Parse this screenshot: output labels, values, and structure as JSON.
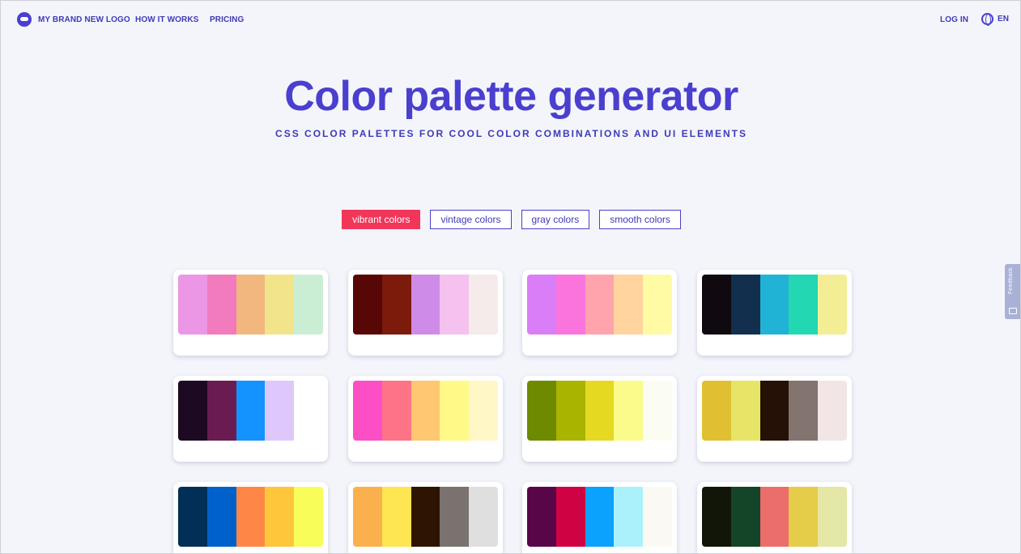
{
  "nav": {
    "brand": "MY BRAND NEW LOGO",
    "brand_icon": "logo-icon",
    "links": [
      "HOW IT WORKS",
      "PRICING"
    ],
    "login": "LOG IN",
    "language": "EN",
    "language_icon": "globe-icon"
  },
  "hero": {
    "title": "Color palette generator",
    "subtitle": "CSS COLOR PALETTES FOR COOL COLOR COMBINATIONS AND UI ELEMENTS"
  },
  "filters": [
    {
      "label": "vibrant colors",
      "active": true
    },
    {
      "label": "vintage colors",
      "active": false
    },
    {
      "label": "gray colors",
      "active": false
    },
    {
      "label": "smooth colors",
      "active": false
    }
  ],
  "palettes": [
    [
      "#ec97e6",
      "#f17bbd",
      "#f1b77f",
      "#f2e48b",
      "#c9eed3"
    ],
    [
      "#560706",
      "#7c1a0b",
      "#cf8be8",
      "#f5c1ee",
      "#f6ebeb"
    ],
    [
      "#d97ef7",
      "#fb74de",
      "#ffa4ac",
      "#ffd49f",
      "#fffaa4"
    ],
    [
      "#100a10",
      "#12304e",
      "#20b3d6",
      "#23d7b3",
      "#f3ee96"
    ],
    [
      "#1d0a22",
      "#6a1c52",
      "#1492fe",
      "#dec8fb",
      "#ffffff"
    ],
    [
      "#fc4fc6",
      "#ff7387",
      "#ffc771",
      "#fff987",
      "#fff7c5"
    ],
    [
      "#6d8a00",
      "#a9b400",
      "#e5d922",
      "#fbfb8b",
      "#fbfdf3"
    ],
    [
      "#e0c030",
      "#e8e467",
      "#251105",
      "#83746f",
      "#f1e5e5"
    ],
    [
      "#022f56",
      "#0061cb",
      "#fe8748",
      "#fec63b",
      "#f8fd5a"
    ],
    [
      "#fbb04e",
      "#fee552",
      "#2e1502",
      "#7a726f",
      "#dfdfdf"
    ],
    [
      "#580648",
      "#cf0344",
      "#0ba2fd",
      "#abf1fb",
      "#fbf9f4"
    ],
    [
      "#121608",
      "#144529",
      "#ec6e6a",
      "#e5cc49",
      "#e4e7a6"
    ]
  ],
  "feedback": {
    "label": "Feedback",
    "icon": "feedback-icon"
  }
}
